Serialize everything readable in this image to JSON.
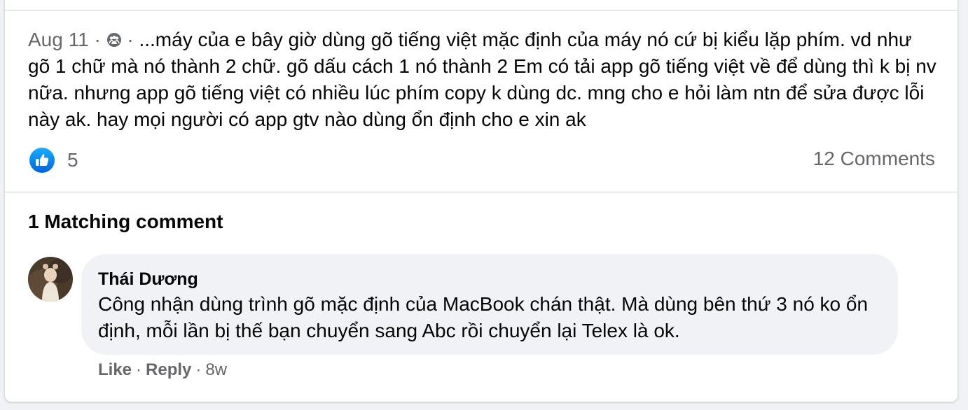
{
  "post": {
    "date": "Aug 11",
    "separator": "·",
    "audience_icon": "group-members-icon",
    "snippet": "...máy của e bây giờ dùng gõ tiếng việt mặc định của máy nó cứ bị kiểu lặp phím. vd như gõ 1 chữ mà nó thành 2 chữ. gõ dấu cách 1 nó thành 2 Em có tải app gõ tiếng việt về để dùng thì k bị nv nữa. nhưng app gõ tiếng việt có nhiều lúc phím copy k dùng dc. mng cho e hỏi làm ntn để sửa được lỗi này ak. hay mọi người có app gtv nào dùng ổn định cho e xin ak"
  },
  "reactions": {
    "icon": "like-reaction-icon",
    "count": "5",
    "comments": "12 Comments"
  },
  "matching": {
    "title": "1 Matching comment"
  },
  "comment": {
    "author": "Thái Dương",
    "text": "Công nhận dùng trình gõ mặc định của MacBook chán thật. Mà dùng bên thứ 3 nó ko ổn định, mỗi lần bị thế bạn chuyển sang Abc rồi chuyển lại Telex là ok.",
    "like_label": "Like",
    "reply_label": "Reply",
    "separator": "·",
    "time": "8w"
  },
  "colors": {
    "like_blue": "#1b74e4",
    "secondary_text": "#65676b",
    "bubble_bg": "#f0f2f5"
  }
}
